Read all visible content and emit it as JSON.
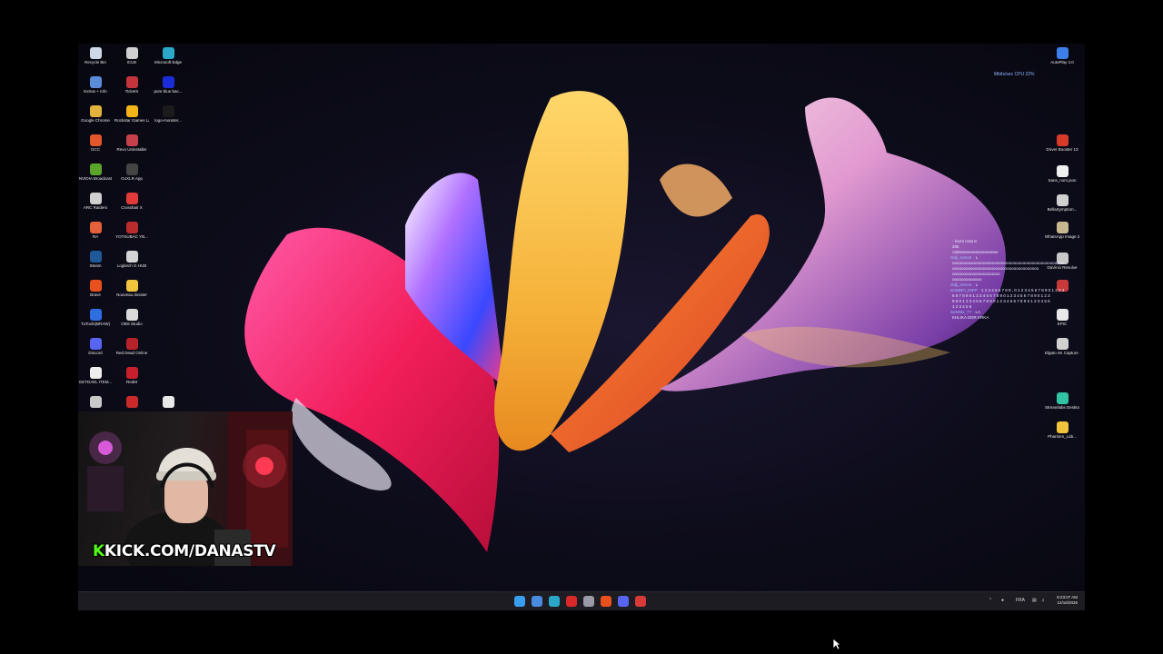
{
  "desktop": {
    "left_icons": [
      {
        "label": "Recycle Bin",
        "icon": "recycle-bin-icon",
        "color": "#cfd8e8"
      },
      {
        "label": "ICUE",
        "icon": "icue-icon",
        "color": "#d0d0d0"
      },
      {
        "label": "Microsoft Edge",
        "icon": "edge-icon",
        "color": "#2ba8c7"
      },
      {
        "label": "Extras + Info",
        "icon": "extras-icon",
        "color": "#5a8cd8"
      },
      {
        "label": "TicketX",
        "icon": "ticket-app-icon",
        "color": "#c4343c"
      },
      {
        "label": "pure blue bac...",
        "icon": "image-file-icon",
        "color": "#1a2cd8"
      },
      {
        "label": "Google Chrome",
        "icon": "chrome-icon",
        "color": "#e2b23a"
      },
      {
        "label": "Rockstar Games Launcher",
        "icon": "rockstar-icon",
        "color": "#f3b417"
      },
      {
        "label": "logo-monster...",
        "icon": "image-file-icon",
        "color": "#1b1b1b"
      },
      {
        "label": "GCC",
        "icon": "gcc-icon",
        "color": "#e3572a"
      },
      {
        "label": "Revo Uninstaller",
        "icon": "revo-icon",
        "color": "#c5404a"
      },
      {
        "label": "",
        "icon": "blank-icon",
        "color": "transparent"
      },
      {
        "label": "NVIDIA Broadcast",
        "icon": "nvidia-icon",
        "color": "#5aa52a"
      },
      {
        "label": "GoXLR App",
        "icon": "goxlr-icon",
        "color": "#444444"
      },
      {
        "label": "",
        "icon": "blank-icon",
        "color": "transparent"
      },
      {
        "label": "ARC Raiders",
        "icon": "arc-icon",
        "color": "#d0d0d0"
      },
      {
        "label": "Crosshair X",
        "icon": "crosshair-icon",
        "color": "#e23a3a"
      },
      {
        "label": "",
        "icon": "blank-icon",
        "color": "transparent"
      },
      {
        "label": "RA",
        "icon": "ra-icon",
        "color": "#e2603a"
      },
      {
        "label": "YOTSUBAC YB...",
        "icon": "app-icon",
        "color": "#b82c2c"
      },
      {
        "label": "",
        "icon": "blank-icon",
        "color": "transparent"
      },
      {
        "label": "Steam",
        "icon": "steam-icon",
        "color": "#1e5a9a"
      },
      {
        "label": "Logitech G HUB",
        "icon": "ghub-icon",
        "color": "#d4d4d4"
      },
      {
        "label": "",
        "icon": "blank-icon",
        "color": "transparent"
      },
      {
        "label": "Brave",
        "icon": "brave-icon",
        "color": "#e8501c"
      },
      {
        "label": "Nouveau dossier",
        "icon": "folder-icon",
        "color": "#f2c43c"
      },
      {
        "label": "",
        "icon": "blank-icon",
        "color": "transparent"
      },
      {
        "label": "TuTools(BRAW)",
        "icon": "tutools-icon",
        "color": "#2f6ee0"
      },
      {
        "label": "OBS Studio",
        "icon": "obs-icon",
        "color": "#dadada"
      },
      {
        "label": "",
        "icon": "blank-icon",
        "color": "transparent"
      },
      {
        "label": "Discord",
        "icon": "discord-icon",
        "color": "#5865f2"
      },
      {
        "label": "Red Dead Online",
        "icon": "rdo-icon",
        "color": "#b8222a"
      },
      {
        "label": "",
        "icon": "blank-icon",
        "color": "transparent"
      },
      {
        "label": "GETDAEL ITEM...",
        "icon": "document-icon",
        "color": "#eeeeee"
      },
      {
        "label": "RedM",
        "icon": "redm-icon",
        "color": "#c8202a"
      },
      {
        "label": "",
        "icon": "blank-icon",
        "color": "transparent"
      },
      {
        "label": "",
        "icon": "app-icon",
        "color": "#c8c8c8"
      },
      {
        "label": "",
        "icon": "app-icon",
        "color": "#c82a2a"
      },
      {
        "label": "",
        "icon": "app-icon",
        "color": "#e8e8e8"
      }
    ],
    "right_icons": [
      {
        "label": "AutoPlay 4.0",
        "icon": "autoplay-icon",
        "color": "#3e7ee8"
      },
      {
        "label": "Driver Booster 13",
        "icon": "driver-booster-icon",
        "color": "#d83a2a"
      },
      {
        "label": "Sans_nom.json",
        "icon": "document-icon",
        "color": "#f0f0f0"
      },
      {
        "label": "BellaSymptom...",
        "icon": "app-icon",
        "color": "#d0d0d0"
      },
      {
        "label": "WhatsApp Image 2025-1...",
        "icon": "image-file-icon",
        "color": "#c8b890"
      },
      {
        "label": "DaVinci Resolve",
        "icon": "davinci-icon",
        "color": "#c8c8c8"
      },
      {
        "label": "",
        "icon": "app-icon",
        "color": "#c83a3a"
      },
      {
        "label": "EPIC",
        "icon": "epic-icon",
        "color": "#e8e8e8"
      },
      {
        "label": "Elgato 4K Capture Utility",
        "icon": "elgato-icon",
        "color": "#d0d0d0"
      },
      {
        "label": "Streamlabs Desktop",
        "icon": "streamlabs-icon",
        "color": "#31c3a2"
      },
      {
        "label": "Phantom_Lab...",
        "icon": "folder-icon",
        "color": "#f2c43c"
      }
    ]
  },
  "network_status": "Mbits/sec  CPU 22%",
  "chat": [
    {
      "user": "",
      "text": "- harm m3a 8"
    },
    {
      "user": "",
      "text": "3IIII"
    },
    {
      "user": "",
      "text": "Adeeeeeeeeeeeeeeeeee"
    },
    {
      "user": "Odji_rorson :",
      "text": "L"
    },
    {
      "user": "",
      "text": "ooooooooooooooooooooooooooooooooooooooooooooooooo"
    },
    {
      "user": "",
      "text": "oooooooooooooooooooooooooooooooooooooo"
    },
    {
      "user": "",
      "text": "ooooooooooooooooooooo"
    },
    {
      "user": "",
      "text": "ooooooooooooo"
    },
    {
      "user": "Odji_rorson :",
      "text": "L"
    },
    {
      "user": "SAKBIO_INFP :",
      "text": "1 2 3 4 5 6 7 8 9 , 0 1 2 3 4 5 6 7 8 9 0 1 2 3 4"
    },
    {
      "user": "",
      "text": "5 6 7 8 9 0 1 2 3 4 5 6 7 8 9 0 1 2 3 4 5 6 7 8 9 0 1 2 3"
    },
    {
      "user": "",
      "text": "8 9 0 1 2 3 4 5 6 7 8 9 0 1 2 3 4 5 6 7 8 9 0 1 2 3 4 5 6"
    },
    {
      "user": "",
      "text": "1 2 3 4 5 6"
    },
    {
      "user": "SoNNIx_77 :",
      "text": "LA"
    },
    {
      "user": "",
      "text": "KHLIKA DDR KRKA"
    }
  ],
  "webcam": {
    "banner_k": "K",
    "banner_text": "KICK.COM/DANASTV"
  },
  "taskbar": {
    "center_icons": [
      {
        "icon": "windows-start-icon",
        "color": "#3a9ef0"
      },
      {
        "icon": "file-explorer-icon",
        "color": "#4a8ae0"
      },
      {
        "icon": "edge-taskbar-icon",
        "color": "#2ba8c7"
      },
      {
        "icon": "red-app-taskbar-icon",
        "color": "#d8282a"
      },
      {
        "icon": "settings-taskbar-icon",
        "color": "#9a9aa8"
      },
      {
        "icon": "brave-taskbar-icon",
        "color": "#e8501c"
      },
      {
        "icon": "discord-taskbar-icon",
        "color": "#5865f2"
      },
      {
        "icon": "ticket-taskbar-icon",
        "color": "#d83a3a"
      }
    ],
    "tray_lang": "FRA",
    "time": "8:23:07 AM",
    "date": "12/16/2026"
  }
}
